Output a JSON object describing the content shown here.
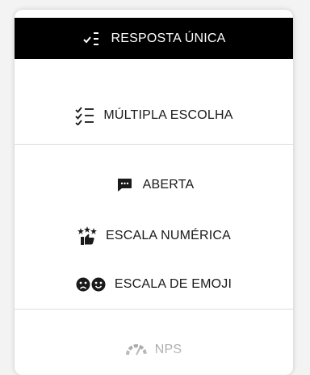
{
  "menu": {
    "items": [
      {
        "label": "RESPOSTA ÚNICA",
        "icon": "single-choice-icon",
        "selected": true
      },
      {
        "label": "MÚLTIPLA ESCOLHA",
        "icon": "multiple-choice-icon",
        "selected": false
      },
      {
        "label": "ABERTA",
        "icon": "chat-icon",
        "selected": false
      },
      {
        "label": "ESCALA NUMÉRICA",
        "icon": "rating-scale-icon",
        "selected": false
      },
      {
        "label": "ESCALA DE EMOJI",
        "icon": "emoji-scale-icon",
        "selected": false
      },
      {
        "label": "NPS",
        "icon": "gauge-icon",
        "selected": false
      }
    ]
  },
  "colors": {
    "selected_bg": "#000000",
    "selected_text": "#ffffff",
    "text": "#1a1a1a",
    "divider": "#dcdcdc"
  }
}
